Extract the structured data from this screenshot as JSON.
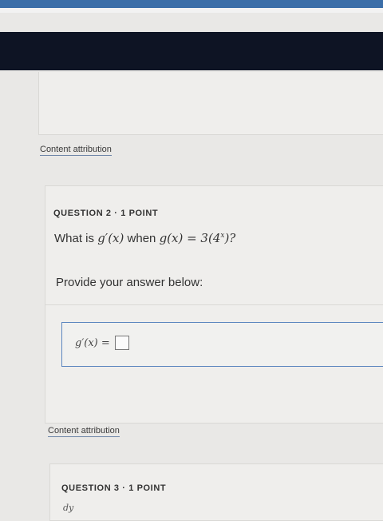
{
  "attributions": {
    "first": "Content attribution",
    "second": "Content attribution"
  },
  "question2": {
    "header": "QUESTION 2 · 1 POINT",
    "prompt_pre": "What is",
    "prompt_func": "g′(x)",
    "prompt_when": "when",
    "prompt_eq": "g(x) = 3(4",
    "prompt_exp": "x",
    "prompt_close": ")?",
    "provide_label": "Provide your answer below:",
    "answer_label": "g′(x) =",
    "answer_value": ""
  },
  "question3": {
    "header": "QUESTION 3 · 1 POINT",
    "partial_text": "dy"
  },
  "colors": {
    "dark_bar": "#0e1424",
    "accent_border": "#5b86bf"
  }
}
